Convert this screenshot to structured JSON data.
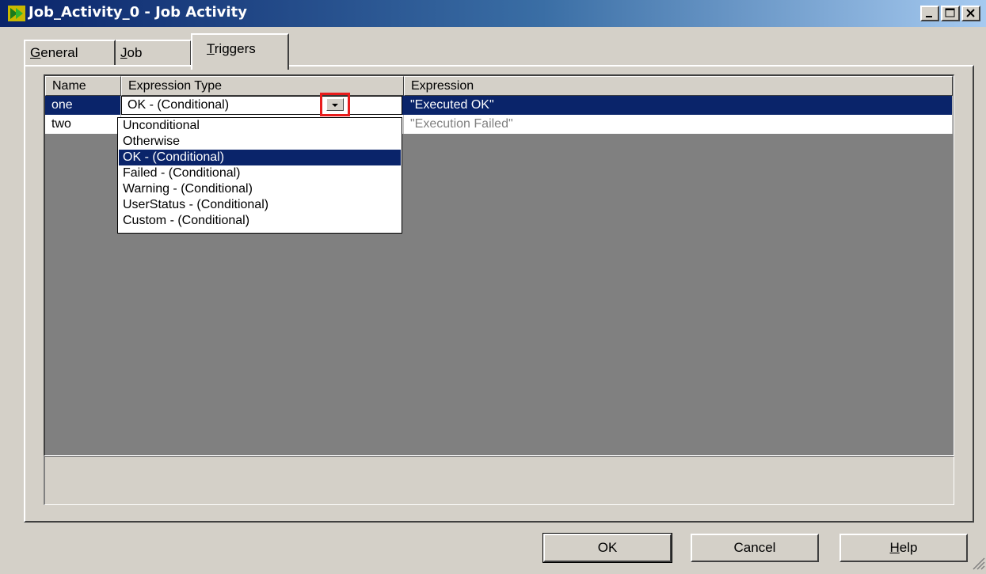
{
  "window": {
    "title": "Job_Activity_0 - Job Activity"
  },
  "tabs": [
    {
      "label": "General",
      "underline": "G"
    },
    {
      "label": "Job",
      "underline": "J"
    },
    {
      "label": "Triggers",
      "underline": "T",
      "active": true
    }
  ],
  "grid": {
    "headers": [
      "Name",
      "Expression Type",
      "Expression"
    ],
    "rows": [
      {
        "name": "one",
        "expression_type": "OK - (Conditional)",
        "expression": "\"Executed OK\"",
        "selected": true
      },
      {
        "name": "two",
        "expression_type": "",
        "expression": "\"Execution Failed\""
      }
    ]
  },
  "dropdown": {
    "options": [
      "Unconditional",
      "Otherwise",
      "OK - (Conditional)",
      "Failed - (Conditional)",
      "Warning - (Conditional)",
      "UserStatus - (Conditional)",
      "Custom - (Conditional)"
    ],
    "selected": "OK - (Conditional)"
  },
  "buttons": {
    "ok": "OK",
    "cancel": "Cancel",
    "help": "Help",
    "help_underline": "H"
  },
  "colors": {
    "selection": "#0a246a",
    "highlight_box": "#e81c1c",
    "face": "#d4d0c8",
    "grid_bg": "#808080"
  },
  "icons": [
    "app-icon",
    "minimize-icon",
    "maximize-icon",
    "close-icon",
    "dropdown-arrow-icon",
    "size-grip-icon"
  ]
}
